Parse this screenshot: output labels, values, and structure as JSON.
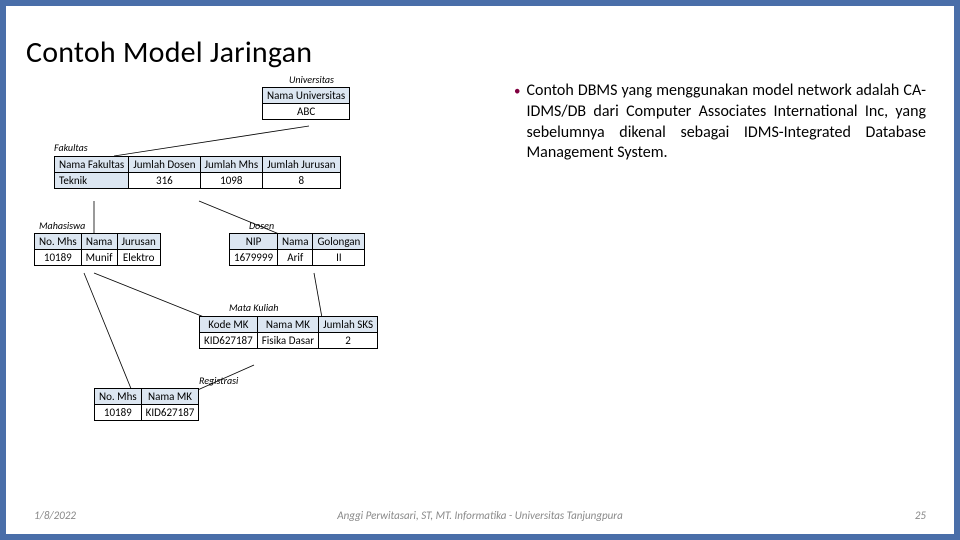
{
  "title": "Contoh Model Jaringan",
  "bullet": "Contoh DBMS yang menggunakan model network adalah CA-IDMS/DB dari Computer Associates International Inc, yang sebelumnya dikenal sebagai IDMS-Integrated Database Management System.",
  "labels": {
    "universitas": "Universitas",
    "fakultas": "Fakultas",
    "mahasiswa": "Mahasiswa",
    "dosen": "Dosen",
    "matakuliah": "Mata Kuliah",
    "registrasi": "Registrasi"
  },
  "univ": {
    "h": "Nama Universitas",
    "v": "ABC"
  },
  "fak": {
    "h": [
      "Nama Fakultas",
      "Jumlah Dosen",
      "Jumlah Mhs",
      "Jumlah Jurusan"
    ],
    "r": [
      "Teknik",
      "316",
      "1098",
      "8"
    ]
  },
  "mhs": {
    "h": [
      "No. Mhs",
      "Nama",
      "Jurusan"
    ],
    "r": [
      "10189",
      "Munif",
      "Elektro"
    ]
  },
  "dsn": {
    "h": [
      "NIP",
      "Nama",
      "Golongan"
    ],
    "r": [
      "1679999",
      "Arif",
      "II"
    ]
  },
  "mk": {
    "h": [
      "Kode MK",
      "Nama MK",
      "Jumlah SKS"
    ],
    "r": [
      "KID627187",
      "Fisika Dasar",
      "2"
    ]
  },
  "reg": {
    "h": [
      "No. Mhs",
      "Nama MK"
    ],
    "r": [
      "10189",
      "KID627187"
    ]
  },
  "footer": {
    "date": "1/8/2022",
    "center": "Anggi Perwitasari, ST, MT. Informatika - Universitas Tanjungpura",
    "page": "25"
  }
}
